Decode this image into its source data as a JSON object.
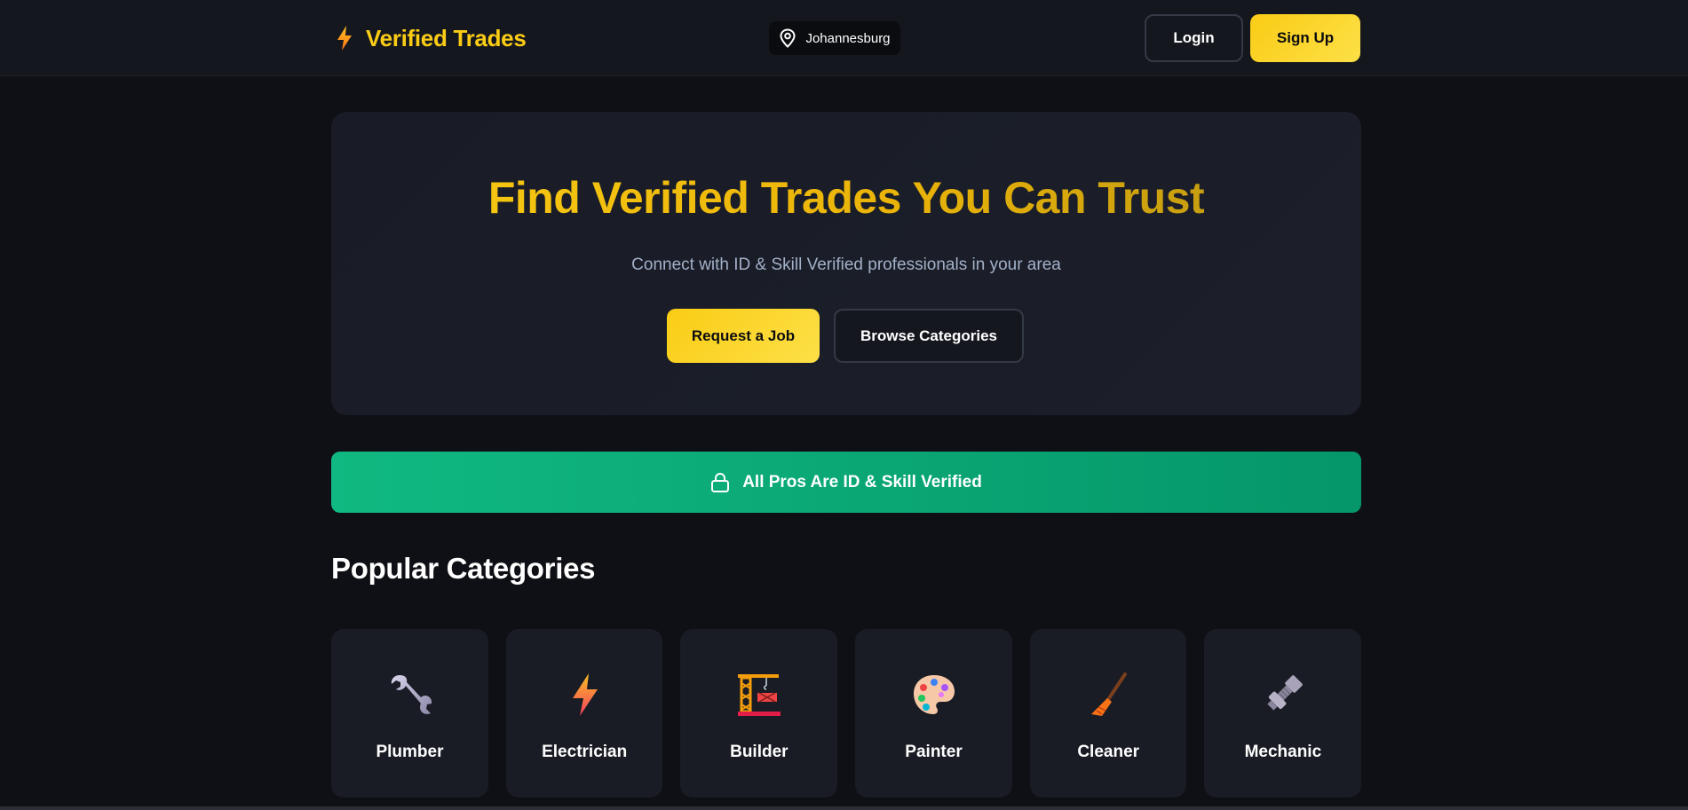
{
  "header": {
    "brand_name": "Verified Trades",
    "brand_icon": "lightning-bolt-icon",
    "location": "Johannesburg",
    "location_icon": "map-pin-icon",
    "login_label": "Login",
    "signup_label": "Sign Up"
  },
  "hero": {
    "title": "Find Verified Trades You Can Trust",
    "subtitle": "Connect with ID & Skill Verified professionals in your area",
    "request_label": "Request a Job",
    "browse_label": "Browse Categories"
  },
  "banner": {
    "text": "All Pros Are ID & Skill Verified",
    "icon": "lock-icon"
  },
  "categories": {
    "title": "Popular Categories",
    "items": [
      {
        "label": "Plumber",
        "icon": "wrench-icon"
      },
      {
        "label": "Electrician",
        "icon": "lightning-bolt-icon"
      },
      {
        "label": "Builder",
        "icon": "construction-crane-icon"
      },
      {
        "label": "Painter",
        "icon": "palette-icon"
      },
      {
        "label": "Cleaner",
        "icon": "broom-icon"
      },
      {
        "label": "Mechanic",
        "icon": "nut-and-bolt-icon"
      }
    ]
  },
  "colors": {
    "accent": "#facc15",
    "background": "#0f1015",
    "surface": "#191c24",
    "success": "#10b981",
    "muted_text": "#a3b0c8"
  }
}
